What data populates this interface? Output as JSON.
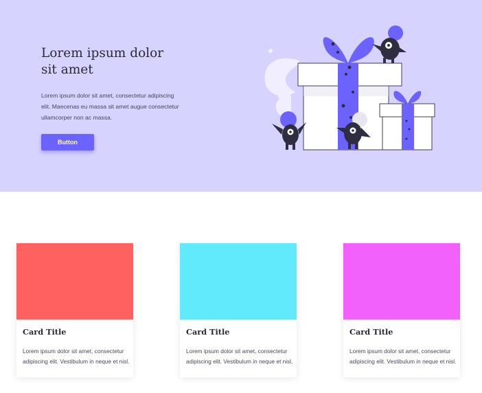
{
  "hero": {
    "title": "Lorem ipsum dolor sit amet",
    "text": "Lorem ipsum dolor sit amet, consectetur adipiscing elit. Maecenas eu massa sit amet augue consectetur ullamcorper non ac massa.",
    "button_label": "Button",
    "background_color": "#d6d3ff",
    "accent_color": "#6c63ff",
    "illustration": "gifts-and-monsters-illustration"
  },
  "cards": [
    {
      "image_color": "#ff6161",
      "title": "Card Title",
      "text": "Lorem ipsum dolor sit amet, consectetur adipiscing elit. Vestibulum in neque et nisl."
    },
    {
      "image_color": "#61eafc",
      "title": "Card Title",
      "text": "Lorem ipsum dolor sit amet, consectetur adipiscing elit. Vestibulum in neque et nisl."
    },
    {
      "image_color": "#f361fc",
      "title": "Card Title",
      "text": "Lorem ipsum dolor sit amet, consectetur adipiscing elit. Vestibulum in neque et nisl."
    }
  ]
}
